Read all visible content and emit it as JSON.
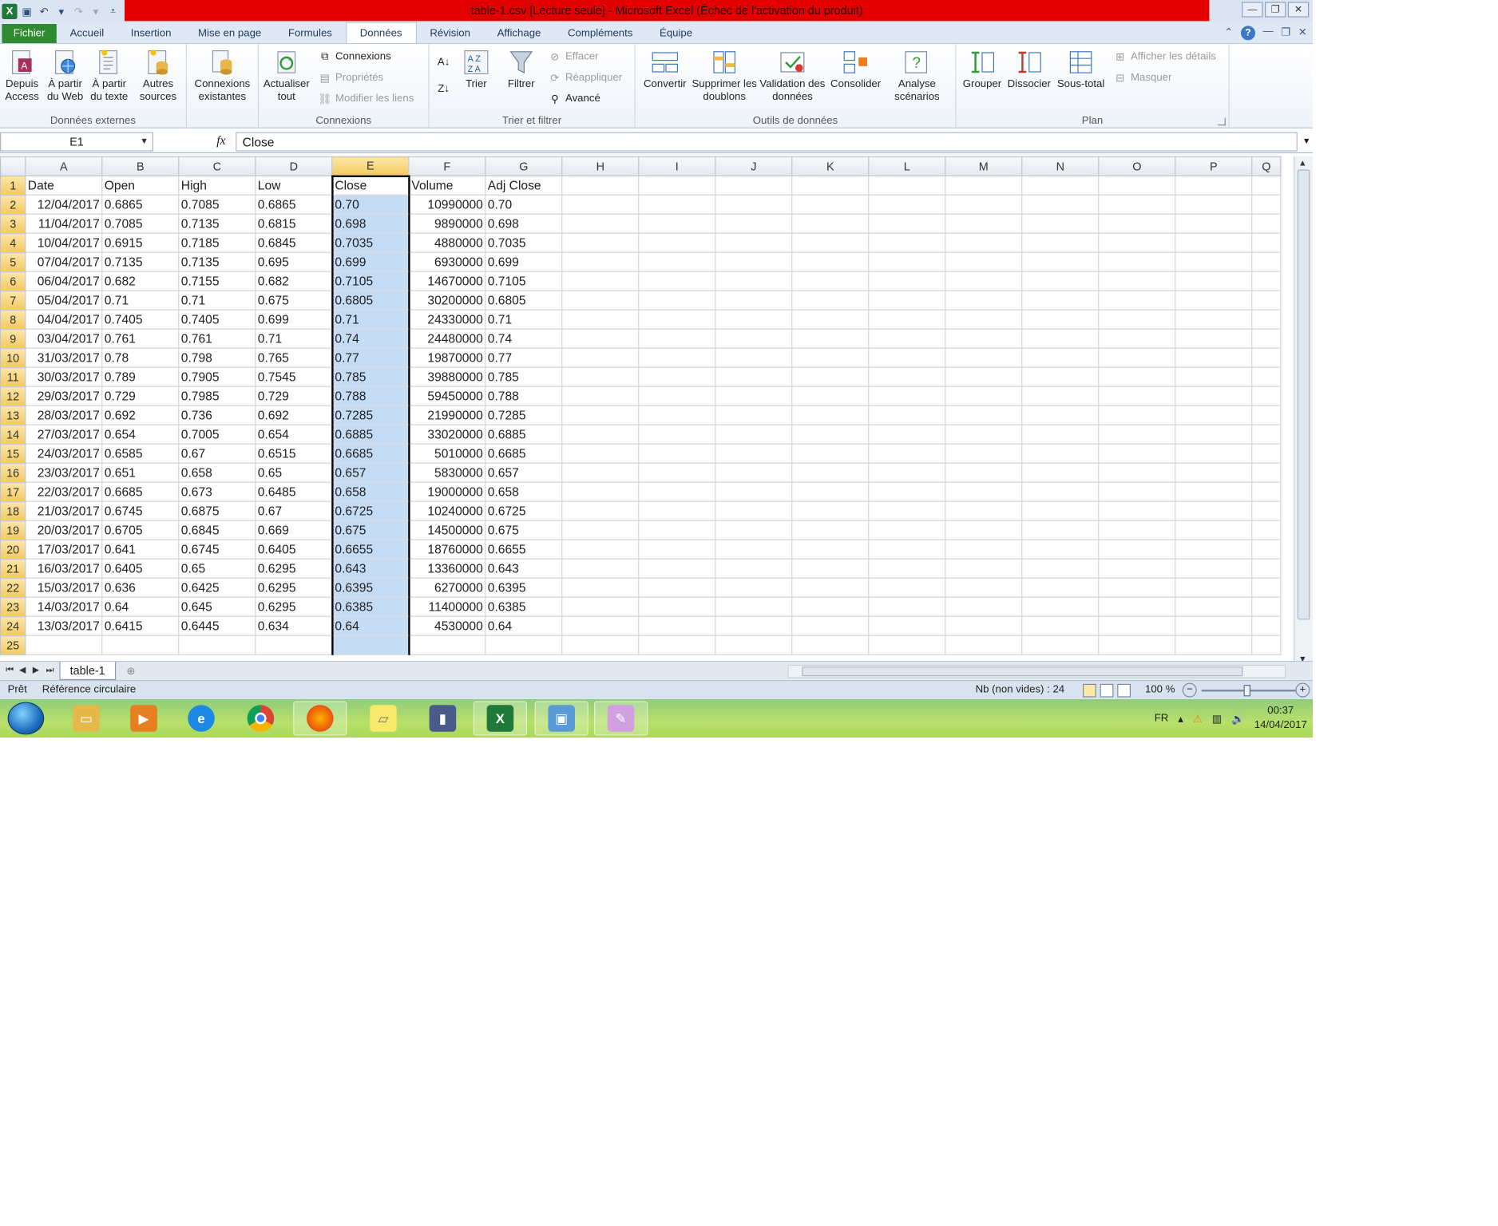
{
  "window": {
    "title": "table-1.csv  [Lecture seule] - Microsoft Excel (Échec de l'activation du produit)"
  },
  "ribbon": {
    "tabs": [
      "Fichier",
      "Accueil",
      "Insertion",
      "Mise en page",
      "Formules",
      "Données",
      "Révision",
      "Affichage",
      "Compléments",
      "Équipe"
    ],
    "active_tab": "Données",
    "groups": {
      "external": {
        "label": "Données externes",
        "access": "Depuis Access",
        "web": "À partir du Web",
        "text": "À partir du texte",
        "other": "Autres sources"
      },
      "existing": {
        "label": "Connexions existantes"
      },
      "connections": {
        "label": "Connexions",
        "refresh": "Actualiser tout",
        "connections": "Connexions",
        "properties": "Propriétés",
        "edit_links": "Modifier les liens"
      },
      "sort": {
        "label": "Trier et filtrer",
        "sort": "Trier",
        "filter": "Filtrer",
        "clear": "Effacer",
        "reapply": "Réappliquer",
        "advanced": "Avancé"
      },
      "tools": {
        "label": "Outils de données",
        "convert": "Convertir",
        "remove_dup": "Supprimer les doublons",
        "validation": "Validation des données",
        "consolidate": "Consolider",
        "whatif": "Analyse scénarios"
      },
      "outline": {
        "label": "Plan",
        "group": "Grouper",
        "ungroup": "Dissocier",
        "subtotal": "Sous-total",
        "show_detail": "Afficher les détails",
        "hide_detail": "Masquer"
      }
    }
  },
  "formula_bar": {
    "name_box": "E1",
    "fx": "fx",
    "content": "Close"
  },
  "grid": {
    "columns": [
      "A",
      "B",
      "C",
      "D",
      "E",
      "F",
      "G",
      "H",
      "I",
      "J",
      "K",
      "L",
      "M",
      "N",
      "O",
      "P",
      "Q"
    ],
    "header_row": [
      "Date",
      "Open",
      "High",
      "Low",
      "Close",
      "Volume",
      "Adj Close"
    ],
    "rows": [
      [
        "12/04/2017",
        "0.6865",
        "0.7085",
        "0.6865",
        "0.70",
        "10990000",
        "0.70"
      ],
      [
        "11/04/2017",
        "0.7085",
        "0.7135",
        "0.6815",
        "0.698",
        "9890000",
        "0.698"
      ],
      [
        "10/04/2017",
        "0.6915",
        "0.7185",
        "0.6845",
        "0.7035",
        "4880000",
        "0.7035"
      ],
      [
        "07/04/2017",
        "0.7135",
        "0.7135",
        "0.695",
        "0.699",
        "6930000",
        "0.699"
      ],
      [
        "06/04/2017",
        "0.682",
        "0.7155",
        "0.682",
        "0.7105",
        "14670000",
        "0.7105"
      ],
      [
        "05/04/2017",
        "0.71",
        "0.71",
        "0.675",
        "0.6805",
        "30200000",
        "0.6805"
      ],
      [
        "04/04/2017",
        "0.7405",
        "0.7405",
        "0.699",
        "0.71",
        "24330000",
        "0.71"
      ],
      [
        "03/04/2017",
        "0.761",
        "0.761",
        "0.71",
        "0.74",
        "24480000",
        "0.74"
      ],
      [
        "31/03/2017",
        "0.78",
        "0.798",
        "0.765",
        "0.77",
        "19870000",
        "0.77"
      ],
      [
        "30/03/2017",
        "0.789",
        "0.7905",
        "0.7545",
        "0.785",
        "39880000",
        "0.785"
      ],
      [
        "29/03/2017",
        "0.729",
        "0.7985",
        "0.729",
        "0.788",
        "59450000",
        "0.788"
      ],
      [
        "28/03/2017",
        "0.692",
        "0.736",
        "0.692",
        "0.7285",
        "21990000",
        "0.7285"
      ],
      [
        "27/03/2017",
        "0.654",
        "0.7005",
        "0.654",
        "0.6885",
        "33020000",
        "0.6885"
      ],
      [
        "24/03/2017",
        "0.6585",
        "0.67",
        "0.6515",
        "0.6685",
        "5010000",
        "0.6685"
      ],
      [
        "23/03/2017",
        "0.651",
        "0.658",
        "0.65",
        "0.657",
        "5830000",
        "0.657"
      ],
      [
        "22/03/2017",
        "0.6685",
        "0.673",
        "0.6485",
        "0.658",
        "19000000",
        "0.658"
      ],
      [
        "21/03/2017",
        "0.6745",
        "0.6875",
        "0.67",
        "0.6725",
        "10240000",
        "0.6725"
      ],
      [
        "20/03/2017",
        "0.6705",
        "0.6845",
        "0.669",
        "0.675",
        "14500000",
        "0.675"
      ],
      [
        "17/03/2017",
        "0.641",
        "0.6745",
        "0.6405",
        "0.6655",
        "18760000",
        "0.6655"
      ],
      [
        "16/03/2017",
        "0.6405",
        "0.65",
        "0.6295",
        "0.643",
        "13360000",
        "0.643"
      ],
      [
        "15/03/2017",
        "0.636",
        "0.6425",
        "0.6295",
        "0.6395",
        "6270000",
        "0.6395"
      ],
      [
        "14/03/2017",
        "0.64",
        "0.645",
        "0.6295",
        "0.6385",
        "11400000",
        "0.6385"
      ],
      [
        "13/03/2017",
        "0.6415",
        "0.6445",
        "0.634",
        "0.64",
        "4530000",
        "0.64"
      ]
    ],
    "selected_column": "E",
    "active_cell": "E1"
  },
  "sheets": {
    "tabs": [
      "table-1"
    ],
    "active": "table-1"
  },
  "status": {
    "ready": "Prêt",
    "circular": "Référence circulaire",
    "count": "Nb (non vides) : 24",
    "zoom": "100 %"
  },
  "taskbar": {
    "apps": [
      "folder-icon",
      "media-player-icon",
      "ie-icon",
      "chrome-icon",
      "firefox-icon",
      "sticky-notes-icon",
      "presentation-icon",
      "excel-icon",
      "photo-viewer-icon",
      "paint-icon"
    ],
    "lang": "FR",
    "time": "00:37",
    "date": "14/04/2017"
  },
  "colors": {
    "title_error": "#e20000",
    "file_tab": "#2f8b2f",
    "selection": "#c5dcf5",
    "header_selected": "#f5c85e"
  }
}
